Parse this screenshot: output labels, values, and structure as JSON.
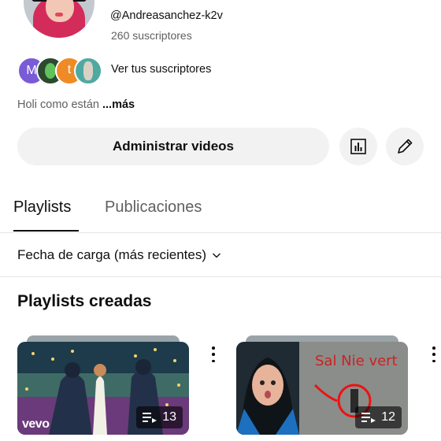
{
  "channel": {
    "handle": "@Andreasanchez-k2v",
    "subscribers": "260 suscriptores",
    "subscriber_avatars": [
      {
        "letter": "M",
        "color": "#7a5bd6"
      },
      {
        "letter": "",
        "color": "#2b4a2e"
      },
      {
        "letter": "t",
        "color": "#f08a24"
      },
      {
        "letter": "",
        "color": "#4fa9a3"
      }
    ],
    "view_subscribers_label": "Ver tus suscriptores",
    "description": "Holi como están",
    "more_label": "...más"
  },
  "actions": {
    "manage_videos_label": "Administrar videos",
    "analytics_icon": "bar-chart-icon",
    "edit_icon": "pencil-icon"
  },
  "tabs": [
    {
      "label": "Playlists",
      "selected": true
    },
    {
      "label": "Publicaciones",
      "selected": false
    }
  ],
  "sort": {
    "label": "Fecha de carga (más recientes)"
  },
  "section": {
    "title": "Playlists creadas"
  },
  "playlists": [
    {
      "count": "13",
      "watermark": "vevo"
    },
    {
      "count": "12",
      "watermark": ""
    }
  ],
  "colors": {
    "primary_text": "#0f0f0f",
    "secondary_text": "#606060",
    "button_bg": "#f2f2f2"
  }
}
